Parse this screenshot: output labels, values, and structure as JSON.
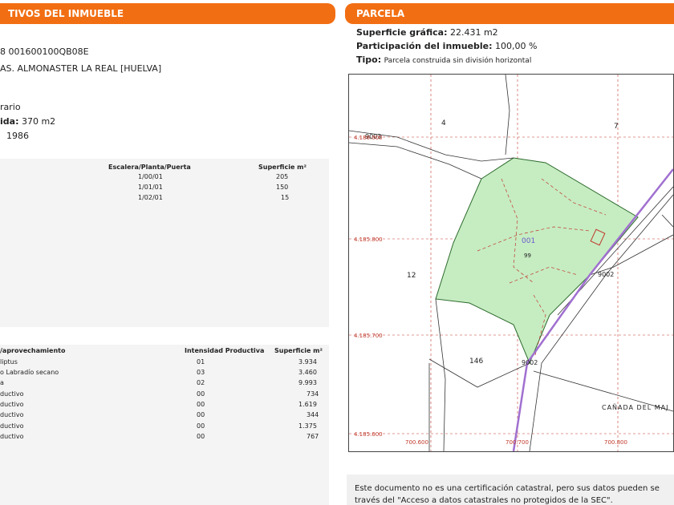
{
  "left_header": "TIVOS DEL INMUEBLE",
  "right_header": "PARCELA",
  "left_lines": {
    "ref": "8 001600100QB08E",
    "address": "AS. ALMONASTER LA REAL [HUELVA]",
    "use": "rario",
    "surface_label": "ida:",
    "surface_value": "370 m2",
    "year": "1986"
  },
  "constr_table": {
    "headers": [
      "Escalera/Planta/Puerta",
      "Superficie m²"
    ],
    "rows": [
      [
        "1/00/01",
        "205"
      ],
      [
        "1/01/01",
        "150"
      ],
      [
        "1/02/01",
        "15"
      ]
    ]
  },
  "crops_table": {
    "headers": [
      "/aprovechamiento",
      "Intensidad Productiva",
      "Superficie m²"
    ],
    "rows": [
      [
        "liptus",
        "01",
        "3.934"
      ],
      [
        "o Labradío secano",
        "03",
        "3.460"
      ],
      [
        "a",
        "02",
        "9.993"
      ],
      [
        "ductivo",
        "00",
        "734"
      ],
      [
        "ductivo",
        "00",
        "1.619"
      ],
      [
        "ductivo",
        "00",
        "344"
      ],
      [
        "ductivo",
        "00",
        "1.375"
      ],
      [
        "ductivo",
        "00",
        "767"
      ]
    ]
  },
  "parcela": {
    "superficie_label": "Superficie gráfica:",
    "superficie_value": "22.431 m2",
    "participacion_label": "Participación del inmueble:",
    "participacion_value": "100,00 %",
    "tipo_label": "Tipo:",
    "tipo_value": "Parcela construida sin división horizontal"
  },
  "map_labels": {
    "p4": "4",
    "p7": "7",
    "p12": "12",
    "p146": "146",
    "p9002a": "9002",
    "p9002b": "9002",
    "p9003": "9003",
    "p001": "001",
    "p99": "99",
    "y1": "4.186.000",
    "y2": "4.185.800",
    "y3": "4.185.700",
    "y4": "4.185.600",
    "x1": "700.600",
    "x2": "700.700",
    "x3": "700.800",
    "road": "CAÑADA DEL MAJ"
  },
  "footer": {
    "line1": "Este documento no es una certificación catastral, pero sus datos pueden se",
    "line2": "través del \"Acceso a datos catastrales no protegidos de la SEC\"."
  },
  "colors": {
    "header": "#f26e12",
    "parcel_fill": "#c6ecc2",
    "road": "#a070d0",
    "grid": "#c0392b"
  }
}
